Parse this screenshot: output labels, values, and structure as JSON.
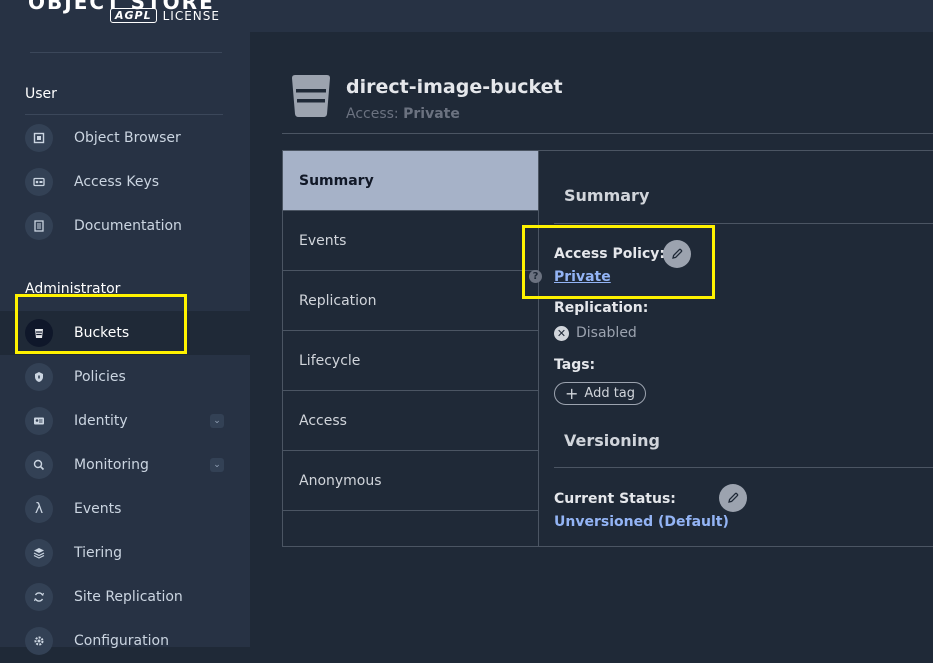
{
  "app": {
    "logo_text": "OBJECT STORE",
    "logo_badge": "AGPL",
    "logo_license": "LICENSE"
  },
  "sidebar": {
    "user_section": "User",
    "user_items": [
      {
        "label": "Object Browser",
        "icon": "object-browser-icon"
      },
      {
        "label": "Access Keys",
        "icon": "access-keys-icon"
      },
      {
        "label": "Documentation",
        "icon": "documentation-icon"
      }
    ],
    "admin_section": "Administrator",
    "admin_items": [
      {
        "label": "Buckets",
        "icon": "bucket-icon",
        "active": true
      },
      {
        "label": "Policies",
        "icon": "policies-icon"
      },
      {
        "label": "Identity",
        "icon": "identity-icon",
        "has_submenu": true
      },
      {
        "label": "Monitoring",
        "icon": "monitoring-icon",
        "has_submenu": true
      },
      {
        "label": "Events",
        "icon": "lambda-icon"
      },
      {
        "label": "Tiering",
        "icon": "tiering-icon"
      },
      {
        "label": "Site Replication",
        "icon": "site-replication-icon"
      },
      {
        "label": "Configuration",
        "icon": "configuration-icon"
      }
    ]
  },
  "bucket": {
    "name": "direct-image-bucket",
    "access_prefix": "Access:",
    "access_value": "Private"
  },
  "tabs": [
    "Summary",
    "Events",
    "Replication",
    "Lifecycle",
    "Access",
    "Anonymous"
  ],
  "active_tab": "Summary",
  "summary": {
    "heading": "Summary",
    "access_policy_label": "Access Policy:",
    "access_policy_value": "Private",
    "help_glyph": "?",
    "replication_label": "Replication:",
    "replication_value": "Disabled",
    "tags_label": "Tags:",
    "add_tag_label": "Add tag"
  },
  "versioning": {
    "heading": "Versioning",
    "current_status_label": "Current Status:",
    "current_status_value": "Unversioned (Default)"
  },
  "colors": {
    "highlight": "#fff200",
    "link": "#93b4f5",
    "active_tab_bg": "#a6b2c8"
  }
}
